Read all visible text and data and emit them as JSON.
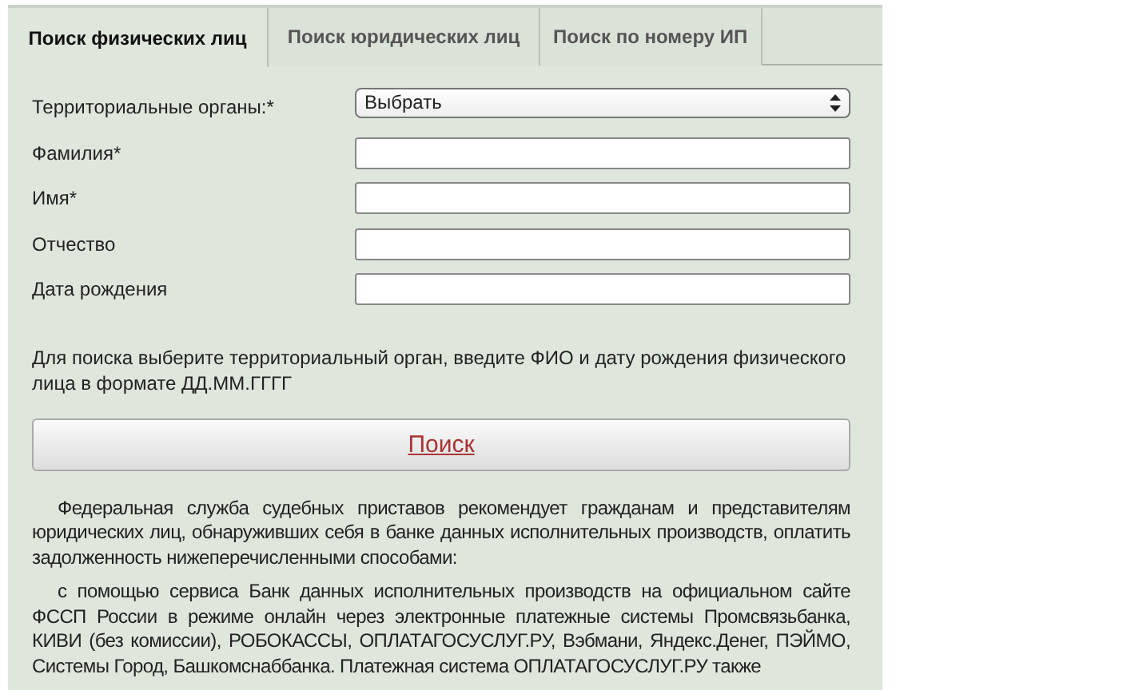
{
  "tabs": [
    {
      "label": "Поиск физических лиц",
      "selected": true
    },
    {
      "label": "Поиск юридических лиц",
      "selected": false
    },
    {
      "label": "Поиск по номеру ИП",
      "selected": false
    }
  ],
  "fields": [
    {
      "kind": "select",
      "label": "Территориальные органы:*",
      "value": "Выбрать"
    },
    {
      "kind": "text",
      "label": "Фамилия*"
    },
    {
      "kind": "text",
      "label": "Имя*"
    },
    {
      "kind": "text",
      "label": "Отчество"
    },
    {
      "kind": "text",
      "label": "Дата рождения"
    }
  ],
  "hint": "Для поиска выберите территориальный орган, введите ФИО и дату рождения физического лица в формате ДД.ММ.ГГГГ",
  "search_button": "Поиск",
  "paragraphs": [
    "Федеральная служба судебных приставов рекомендует гражданам и представителям юридических лиц, обнаруживших себя в банке данных исполнительных производств, оплатить задолженность нижеперечисленными способами:",
    "с помощью сервиса Банк данных исполнительных производств на официальном сайте ФССП России в режиме онлайн через электронные платежные системы Промсвязьбанка, КИВИ (без комиссии), РОБОКАССЫ, ОПЛАТАГОСУСЛУГ.РУ, Вэбмани, Яндекс.Денег, ПЭЙМО, Системы Город, Башкомснаббанка. Платежная система ОПЛАТАГОСУСЛУГ.РУ также"
  ]
}
